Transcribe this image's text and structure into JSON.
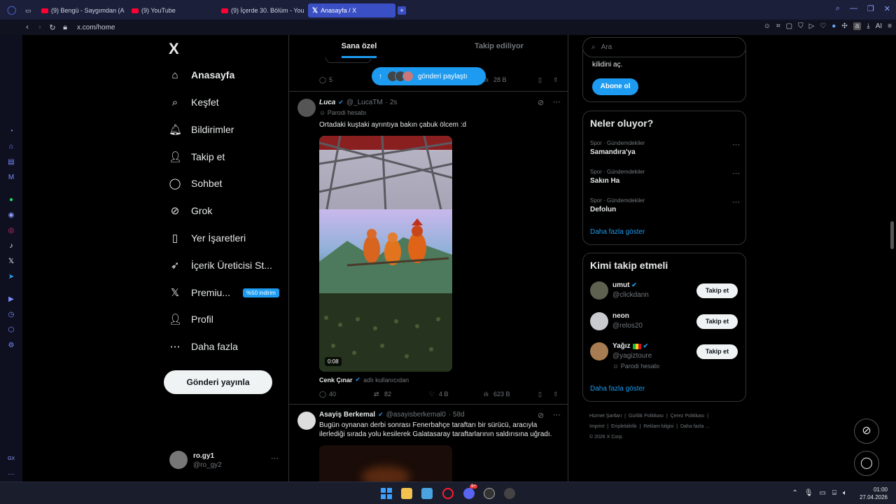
{
  "browser": {
    "tabs": [
      {
        "label": "(9) Bengü - Saygımdan (A"
      },
      {
        "label": "(9) YouTube"
      },
      {
        "label": "(9) İçerde 30. Bölüm - You"
      },
      {
        "label": "Anasayfa / X"
      }
    ],
    "new_tab": "+",
    "url": "x.com/home",
    "ai_label": "AI",
    "ext_letter": "a"
  },
  "sidebar": {
    "logo": "X",
    "items": [
      {
        "label": "Anasayfa",
        "icon": "home-icon"
      },
      {
        "label": "Keşfet",
        "icon": "search-icon"
      },
      {
        "label": "Bildirimler",
        "icon": "bell-icon"
      },
      {
        "label": "Takip et",
        "icon": "follow-icon"
      },
      {
        "label": "Sohbet",
        "icon": "chat-icon"
      },
      {
        "label": "Grok",
        "icon": "grok-icon"
      },
      {
        "label": "Yer İşaretleri",
        "icon": "bookmark-icon"
      },
      {
        "label": "İçerik Üreticisi St...",
        "icon": "rocket-icon"
      },
      {
        "label": "Premiu...",
        "icon": "x-icon",
        "badge": "%50 indirim"
      },
      {
        "label": "Profil",
        "icon": "profile-icon"
      },
      {
        "label": "Daha fazla",
        "icon": "more-icon"
      }
    ],
    "post_button": "Gönderi yayınla",
    "account": {
      "name": "ro.gy1",
      "handle": "@ro_gy2"
    }
  },
  "feed": {
    "tabs": [
      "Sana özel",
      "Takip ediliyor"
    ],
    "new_posts_pill": "gönderi paylaştı",
    "prev_tweet_stats": {
      "replies": "5",
      "views": "28 B"
    },
    "tweets": [
      {
        "name": "Luca",
        "handle": "@_LucaTM",
        "time": "· 2s",
        "label": "Parodi hesabı",
        "text": "Ortadaki kuştaki ayrıntıya bakın çabuk ölcem :d",
        "video_time": "0:08",
        "credit_name": "Cenk Çınar",
        "credit_suffix": "adlı kullanıcıdan",
        "replies": "40",
        "reposts": "82",
        "likes": "4 B",
        "views": "623 B"
      },
      {
        "name": "Asayiş Berkemal",
        "handle": "@asayisberkemal0",
        "time": "· 58d",
        "text": "Bugün oynanan derbi sonrası Fenerbahçe taraftarı bir sürücü, aracıyla ilerlediği sırada yolu kesilerek Galatasaray taraftarlarının saldırısına uğradı."
      }
    ]
  },
  "right": {
    "search_placeholder": "Ara",
    "premium_card": {
      "text": "kilidini aç.",
      "button": "Abone ol"
    },
    "trends": {
      "title": "Neler oluyor?",
      "items": [
        {
          "meta": "Spor · Gündemdekiler",
          "name": "Samandıra'ya"
        },
        {
          "meta": "Spor · Gündemdekiler",
          "name": "Sakın Ha"
        },
        {
          "meta": "Spor · Gündemdekiler",
          "name": "Defolun"
        }
      ],
      "show_more": "Daha fazla göster"
    },
    "who_to_follow": {
      "title": "Kimi takip etmeli",
      "users": [
        {
          "name": "umut",
          "handle": "@clickdann",
          "button": "Takip et"
        },
        {
          "name": "neon",
          "handle": "@relos20",
          "button": "Takip et"
        },
        {
          "name": "Yağız",
          "handle": "@yagiztoure",
          "label": "Parodi hesabı",
          "button": "Takip et"
        }
      ],
      "show_more": "Daha fazla göster"
    },
    "footer": {
      "line1": [
        "Hizmet Şartları",
        "Gizlilik Politikası",
        "Çerez Politikası"
      ],
      "line2": [
        "Imprint",
        "Erişilebilirlik",
        "Reklam bilgisi",
        "Daha fazla ..."
      ],
      "copyright": "© 2026 X Corp."
    }
  },
  "taskbar": {
    "time": "01:00",
    "date": "27.04.2026",
    "discord_badge": "9+"
  },
  "opera_sidebar": {
    "gx_label": "GX"
  }
}
